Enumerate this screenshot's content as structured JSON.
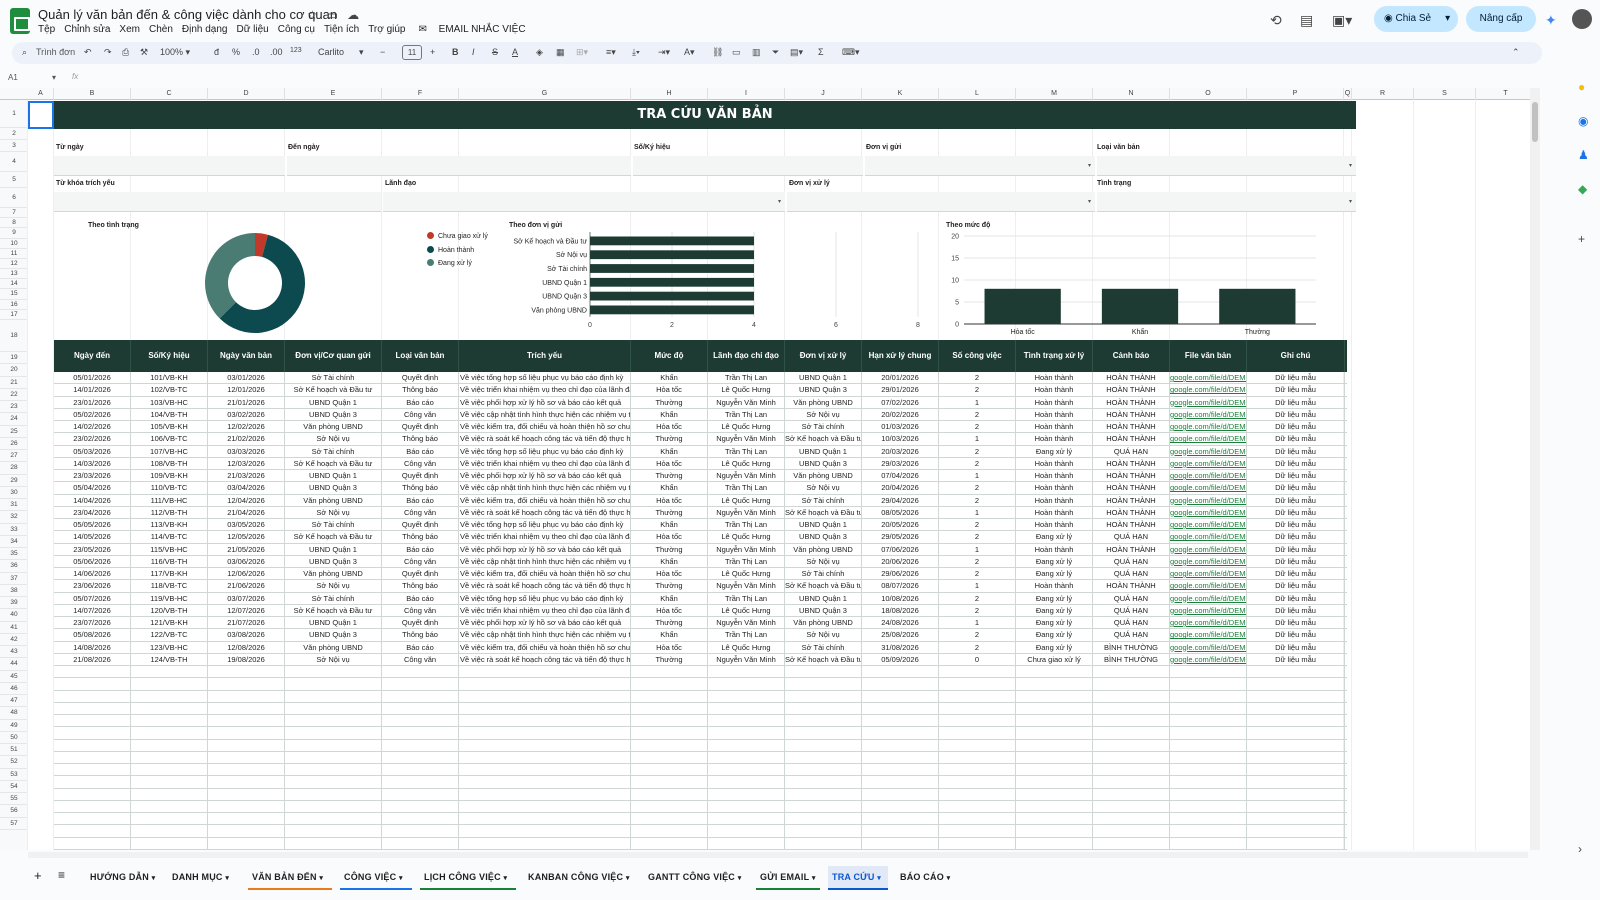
{
  "app": {
    "title": "Quản lý văn bản đến & công việc dành cho cơ quan",
    "menu": [
      "Tệp",
      "Chỉnh sửa",
      "Xem",
      "Chèn",
      "Định dạng",
      "Dữ liệu",
      "Công cụ",
      "Tiện ích",
      "Trợ giúp"
    ],
    "email_menu": "EMAIL NHẮC VIỆC",
    "share_label": "Chia Sẻ",
    "upgrade_label": "Nâng cấp"
  },
  "toolbar": {
    "search_placeholder": "Trình đơn",
    "zoom": "100%",
    "currency": "đ",
    "percent": "%",
    "decrease_decimal": ".0",
    "increase_decimal": ".00",
    "number_format": "123",
    "font": "Carlito",
    "font_size": "11"
  },
  "formula_bar": {
    "cell": "A1",
    "fx": "fx",
    "value": ""
  },
  "columns": [
    "A",
    "B",
    "C",
    "D",
    "E",
    "F",
    "G",
    "H",
    "I",
    "J",
    "K",
    "L",
    "M",
    "N",
    "O",
    "P",
    "Q",
    "R",
    "S",
    "T"
  ],
  "rows": [
    "1",
    "2",
    "3",
    "4",
    "5",
    "6",
    "7",
    "8",
    "9",
    "10",
    "11",
    "12",
    "13",
    "14",
    "15",
    "16",
    "17",
    "18",
    "19",
    "20",
    "21",
    "22",
    "23",
    "24",
    "25",
    "26",
    "27",
    "28",
    "29",
    "30",
    "31",
    "32",
    "33",
    "34",
    "35",
    "36",
    "37",
    "38",
    "39",
    "40",
    "41",
    "42",
    "43",
    "44",
    "45",
    "46",
    "47",
    "48",
    "49",
    "50",
    "51",
    "52",
    "53",
    "54",
    "55",
    "56",
    "57"
  ],
  "banner": "TRA CỨU VĂN BẢN",
  "filters": {
    "from_date": "Từ ngày",
    "to_date": "Đến ngày",
    "number": "Số/Ký hiệu",
    "sender": "Đơn vị gửi",
    "doc_type": "Loại văn bản",
    "keyword": "Từ khóa trích yếu",
    "leader": "Lãnh đạo",
    "handler": "Đơn vị xử lý",
    "status": "Tình trạng"
  },
  "chart_data": [
    {
      "type": "pie",
      "title": "Theo tình trạng",
      "labels": [
        "Chưa giao xử lý",
        "Hoàn thành",
        "Đang xử lý"
      ],
      "values": [
        1,
        14,
        9
      ],
      "colors": [
        "#c0392b",
        "#0d4a4f",
        "#4a7c74"
      ],
      "donut": true,
      "legend": "right"
    },
    {
      "type": "bar",
      "orientation": "horizontal",
      "title": "Theo đơn vị gửi",
      "categories": [
        "Sở Kế hoạch và Đầu tư",
        "Sở Nội vụ",
        "Sở Tài chính",
        "UBND Quận 1",
        "UBND Quận 3",
        "Văn phòng UBND"
      ],
      "values": [
        4,
        4,
        4,
        4,
        4,
        4
      ],
      "xlim": [
        0,
        8
      ],
      "xticks": [
        "0",
        "2",
        "4",
        "6",
        "8"
      ],
      "color": "#1d3b32"
    },
    {
      "type": "bar",
      "title": "Theo mức độ",
      "categories": [
        "Hỏa tốc",
        "Khẩn",
        "Thường"
      ],
      "values": [
        8,
        8,
        8
      ],
      "ylim": [
        0,
        20
      ],
      "yticks": [
        "0",
        "5",
        "10",
        "15",
        "20"
      ],
      "color": "#1d3b32"
    }
  ],
  "table": {
    "headers": [
      "Ngày đến",
      "Số/Ký hiệu",
      "Ngày văn bản",
      "Đơn vị/Cơ quan gửi",
      "Loại văn bản",
      "Trích yếu",
      "Mức độ",
      "Lãnh đạo chỉ đạo",
      "Đơn vị xử lý",
      "Hạn xử lý chung",
      "Số công việc",
      "Tình trạng xử lý",
      "Cảnh báo",
      "File văn bản",
      "Ghi chú"
    ],
    "rows": [
      [
        "05/01/2026",
        "101/VB-KH",
        "03/01/2026",
        "Sở Tài chính",
        "Quyết định",
        "Về việc tổng hợp số liệu phục vụ báo cáo định kỳ",
        "Khẩn",
        "Trần Thị Lan",
        "UBND Quận 1",
        "20/01/2026",
        "2",
        "Hoàn thành",
        "HOÀN THÀNH",
        "google.com/file/d/DEMO",
        "Dữ liệu mẫu"
      ],
      [
        "14/01/2026",
        "102/VB-TC",
        "12/01/2026",
        "Sở Kế hoạch và Đầu tư",
        "Thông báo",
        "Về việc triển khai nhiệm vụ theo chỉ đạo của lãnh đạo",
        "Hỏa tốc",
        "Lê Quốc Hưng",
        "UBND Quận 3",
        "29/01/2026",
        "2",
        "Hoàn thành",
        "HOÀN THÀNH",
        "google.com/file/d/DEMO",
        "Dữ liệu mẫu"
      ],
      [
        "23/01/2026",
        "103/VB-HC",
        "21/01/2026",
        "UBND Quận 1",
        "Báo cáo",
        "Về việc phối hợp xử lý hồ sơ và báo cáo kết quả",
        "Thường",
        "Nguyễn Văn Minh",
        "Văn phòng UBND",
        "07/02/2026",
        "1",
        "Hoàn thành",
        "HOÀN THÀNH",
        "google.com/file/d/DEMO",
        "Dữ liệu mẫu"
      ],
      [
        "05/02/2026",
        "104/VB-TH",
        "03/02/2026",
        "UBND Quận 3",
        "Công văn",
        "Về việc cập nhật tình hình thực hiện các nhiệm vụ trọng tâm",
        "Khẩn",
        "Trần Thị Lan",
        "Sở Nội vụ",
        "20/02/2026",
        "2",
        "Hoàn thành",
        "HOÀN THÀNH",
        "google.com/file/d/DEMO",
        "Dữ liệu mẫu"
      ],
      [
        "14/02/2026",
        "105/VB-KH",
        "12/02/2026",
        "Văn phòng UBND",
        "Quyết định",
        "Về việc kiểm tra, đối chiếu và hoàn thiện hồ sơ chuyên đề",
        "Hỏa tốc",
        "Lê Quốc Hưng",
        "Sở Tài chính",
        "01/03/2026",
        "2",
        "Hoàn thành",
        "HOÀN THÀNH",
        "google.com/file/d/DEMO",
        "Dữ liệu mẫu"
      ],
      [
        "23/02/2026",
        "106/VB-TC",
        "21/02/2026",
        "Sở Nội vụ",
        "Thông báo",
        "Về việc rà soát kế hoạch công tác và tiến độ thực hiện nhiệm vụ",
        "Thường",
        "Nguyễn Văn Minh",
        "Sở Kế hoạch và Đầu tư",
        "10/03/2026",
        "1",
        "Hoàn thành",
        "HOÀN THÀNH",
        "google.com/file/d/DEMO",
        "Dữ liệu mẫu"
      ],
      [
        "05/03/2026",
        "107/VB-HC",
        "03/03/2026",
        "Sở Tài chính",
        "Báo cáo",
        "Về việc tổng hợp số liệu phục vụ báo cáo định kỳ",
        "Khẩn",
        "Trần Thị Lan",
        "UBND Quận 1",
        "20/03/2026",
        "2",
        "Đang xử lý",
        "QUÁ HẠN",
        "google.com/file/d/DEMO",
        "Dữ liệu mẫu"
      ],
      [
        "14/03/2026",
        "108/VB-TH",
        "12/03/2026",
        "Sở Kế hoạch và Đầu tư",
        "Công văn",
        "Về việc triển khai nhiệm vụ theo chỉ đạo của lãnh đạo",
        "Hỏa tốc",
        "Lê Quốc Hưng",
        "UBND Quận 3",
        "29/03/2026",
        "2",
        "Hoàn thành",
        "HOÀN THÀNH",
        "google.com/file/d/DEMO",
        "Dữ liệu mẫu"
      ],
      [
        "23/03/2026",
        "109/VB-KH",
        "21/03/2026",
        "UBND Quận 1",
        "Quyết định",
        "Về việc phối hợp xử lý hồ sơ và báo cáo kết quả",
        "Thường",
        "Nguyễn Văn Minh",
        "Văn phòng UBND",
        "07/04/2026",
        "1",
        "Hoàn thành",
        "HOÀN THÀNH",
        "google.com/file/d/DEMO",
        "Dữ liệu mẫu"
      ],
      [
        "05/04/2026",
        "110/VB-TC",
        "03/04/2026",
        "UBND Quận 3",
        "Thông báo",
        "Về việc cập nhật tình hình thực hiện các nhiệm vụ trọng tâm",
        "Khẩn",
        "Trần Thị Lan",
        "Sở Nội vụ",
        "20/04/2026",
        "2",
        "Hoàn thành",
        "HOÀN THÀNH",
        "google.com/file/d/DEMO",
        "Dữ liệu mẫu"
      ],
      [
        "14/04/2026",
        "111/VB-HC",
        "12/04/2026",
        "Văn phòng UBND",
        "Báo cáo",
        "Về việc kiểm tra, đối chiếu và hoàn thiện hồ sơ chuyên đề",
        "Hỏa tốc",
        "Lê Quốc Hưng",
        "Sở Tài chính",
        "29/04/2026",
        "2",
        "Hoàn thành",
        "HOÀN THÀNH",
        "google.com/file/d/DEMO",
        "Dữ liệu mẫu"
      ],
      [
        "23/04/2026",
        "112/VB-TH",
        "21/04/2026",
        "Sở Nội vụ",
        "Công văn",
        "Về việc rà soát kế hoạch công tác và tiến độ thực hiện nhiệm vụ",
        "Thường",
        "Nguyễn Văn Minh",
        "Sở Kế hoạch và Đầu tư",
        "08/05/2026",
        "1",
        "Hoàn thành",
        "HOÀN THÀNH",
        "google.com/file/d/DEMO",
        "Dữ liệu mẫu"
      ],
      [
        "05/05/2026",
        "113/VB-KH",
        "03/05/2026",
        "Sở Tài chính",
        "Quyết định",
        "Về việc tổng hợp số liệu phục vụ báo cáo định kỳ",
        "Khẩn",
        "Trần Thị Lan",
        "UBND Quận 1",
        "20/05/2026",
        "2",
        "Hoàn thành",
        "HOÀN THÀNH",
        "google.com/file/d/DEMO",
        "Dữ liệu mẫu"
      ],
      [
        "14/05/2026",
        "114/VB-TC",
        "12/05/2026",
        "Sở Kế hoạch và Đầu tư",
        "Thông báo",
        "Về việc triển khai nhiệm vụ theo chỉ đạo của lãnh đạo",
        "Hỏa tốc",
        "Lê Quốc Hưng",
        "UBND Quận 3",
        "29/05/2026",
        "2",
        "Đang xử lý",
        "QUÁ HẠN",
        "google.com/file/d/DEMO",
        "Dữ liệu mẫu"
      ],
      [
        "23/05/2026",
        "115/VB-HC",
        "21/05/2026",
        "UBND Quận 1",
        "Báo cáo",
        "Về việc phối hợp xử lý hồ sơ và báo cáo kết quả",
        "Thường",
        "Nguyễn Văn Minh",
        "Văn phòng UBND",
        "07/06/2026",
        "1",
        "Hoàn thành",
        "HOÀN THÀNH",
        "google.com/file/d/DEMO",
        "Dữ liệu mẫu"
      ],
      [
        "05/06/2026",
        "116/VB-TH",
        "03/06/2026",
        "UBND Quận 3",
        "Công văn",
        "Về việc cập nhật tình hình thực hiện các nhiệm vụ trọng tâm",
        "Khẩn",
        "Trần Thị Lan",
        "Sở Nội vụ",
        "20/06/2026",
        "2",
        "Đang xử lý",
        "QUÁ HẠN",
        "google.com/file/d/DEMO",
        "Dữ liệu mẫu"
      ],
      [
        "14/06/2026",
        "117/VB-KH",
        "12/06/2026",
        "Văn phòng UBND",
        "Quyết định",
        "Về việc kiểm tra, đối chiếu và hoàn thiện hồ sơ chuyên đề",
        "Hỏa tốc",
        "Lê Quốc Hưng",
        "Sở Tài chính",
        "29/06/2026",
        "2",
        "Đang xử lý",
        "QUÁ HẠN",
        "google.com/file/d/DEMO",
        "Dữ liệu mẫu"
      ],
      [
        "23/06/2026",
        "118/VB-TC",
        "21/06/2026",
        "Sở Nội vụ",
        "Thông báo",
        "Về việc rà soát kế hoạch công tác và tiến độ thực hiện nhiệm vụ",
        "Thường",
        "Nguyễn Văn Minh",
        "Sở Kế hoạch và Đầu tư",
        "08/07/2026",
        "1",
        "Hoàn thành",
        "HOÀN THÀNH",
        "google.com/file/d/DEMO",
        "Dữ liệu mẫu"
      ],
      [
        "05/07/2026",
        "119/VB-HC",
        "03/07/2026",
        "Sở Tài chính",
        "Báo cáo",
        "Về việc tổng hợp số liệu phục vụ báo cáo định kỳ",
        "Khẩn",
        "Trần Thị Lan",
        "UBND Quận 1",
        "10/08/2026",
        "2",
        "Đang xử lý",
        "QUÁ HẠN",
        "google.com/file/d/DEMO",
        "Dữ liệu mẫu"
      ],
      [
        "14/07/2026",
        "120/VB-TH",
        "12/07/2026",
        "Sở Kế hoạch và Đầu tư",
        "Công văn",
        "Về việc triển khai nhiệm vụ theo chỉ đạo của lãnh đạo",
        "Hỏa tốc",
        "Lê Quốc Hưng",
        "UBND Quận 3",
        "18/08/2026",
        "2",
        "Đang xử lý",
        "QUÁ HẠN",
        "google.com/file/d/DEMO",
        "Dữ liệu mẫu"
      ],
      [
        "23/07/2026",
        "121/VB-KH",
        "21/07/2026",
        "UBND Quận 1",
        "Quyết định",
        "Về việc phối hợp xử lý hồ sơ và báo cáo kết quả",
        "Thường",
        "Nguyễn Văn Minh",
        "Văn phòng UBND",
        "24/08/2026",
        "1",
        "Đang xử lý",
        "QUÁ HẠN",
        "google.com/file/d/DEMO",
        "Dữ liệu mẫu"
      ],
      [
        "05/08/2026",
        "122/VB-TC",
        "03/08/2026",
        "UBND Quận 3",
        "Thông báo",
        "Về việc cập nhật tình hình thực hiện các nhiệm vụ trọng tâm",
        "Khẩn",
        "Trần Thị Lan",
        "Sở Nội vụ",
        "25/08/2026",
        "2",
        "Đang xử lý",
        "QUÁ HẠN",
        "google.com/file/d/DEMO",
        "Dữ liệu mẫu"
      ],
      [
        "14/08/2026",
        "123/VB-HC",
        "12/08/2026",
        "Văn phòng UBND",
        "Báo cáo",
        "Về việc kiểm tra, đối chiếu và hoàn thiện hồ sơ chuyên đề",
        "Hỏa tốc",
        "Lê Quốc Hưng",
        "Sở Tài chính",
        "31/08/2026",
        "2",
        "Đang xử lý",
        "BÌNH THƯỜNG",
        "google.com/file/d/DEMO",
        "Dữ liệu mẫu"
      ],
      [
        "21/08/2026",
        "124/VB-TH",
        "19/08/2026",
        "Sở Nội vụ",
        "Công văn",
        "Về việc rà soát kế hoạch công tác và tiến độ thực hiện nhiệm vụ",
        "Thường",
        "Nguyễn Văn Minh",
        "Sở Kế hoạch và Đầu tư",
        "05/09/2026",
        "0",
        "Chưa giao xử lý",
        "BÌNH THƯỜNG",
        "google.com/file/d/DEMO",
        "Dữ liệu mẫu"
      ]
    ]
  },
  "sheet_tabs": [
    "HƯỚNG DẪN",
    "DANH MỤC",
    "VĂN BẢN ĐẾN",
    "CÔNG VIỆC",
    "LỊCH CÔNG VIỆC",
    "KANBAN CÔNG VIỆC",
    "GANTT CÔNG VIỆC",
    "GỬI EMAIL",
    "TRA CỨU",
    "BÁO CÁO"
  ],
  "active_tab": "TRA CỨU",
  "tab_colors": [
    "#ffffff",
    "#ffffff",
    "#e67c1c",
    "#1a73e8",
    "#188038",
    "#ffffff",
    "#ffffff",
    "#188038",
    "#0b57d0",
    "#ffffff"
  ]
}
